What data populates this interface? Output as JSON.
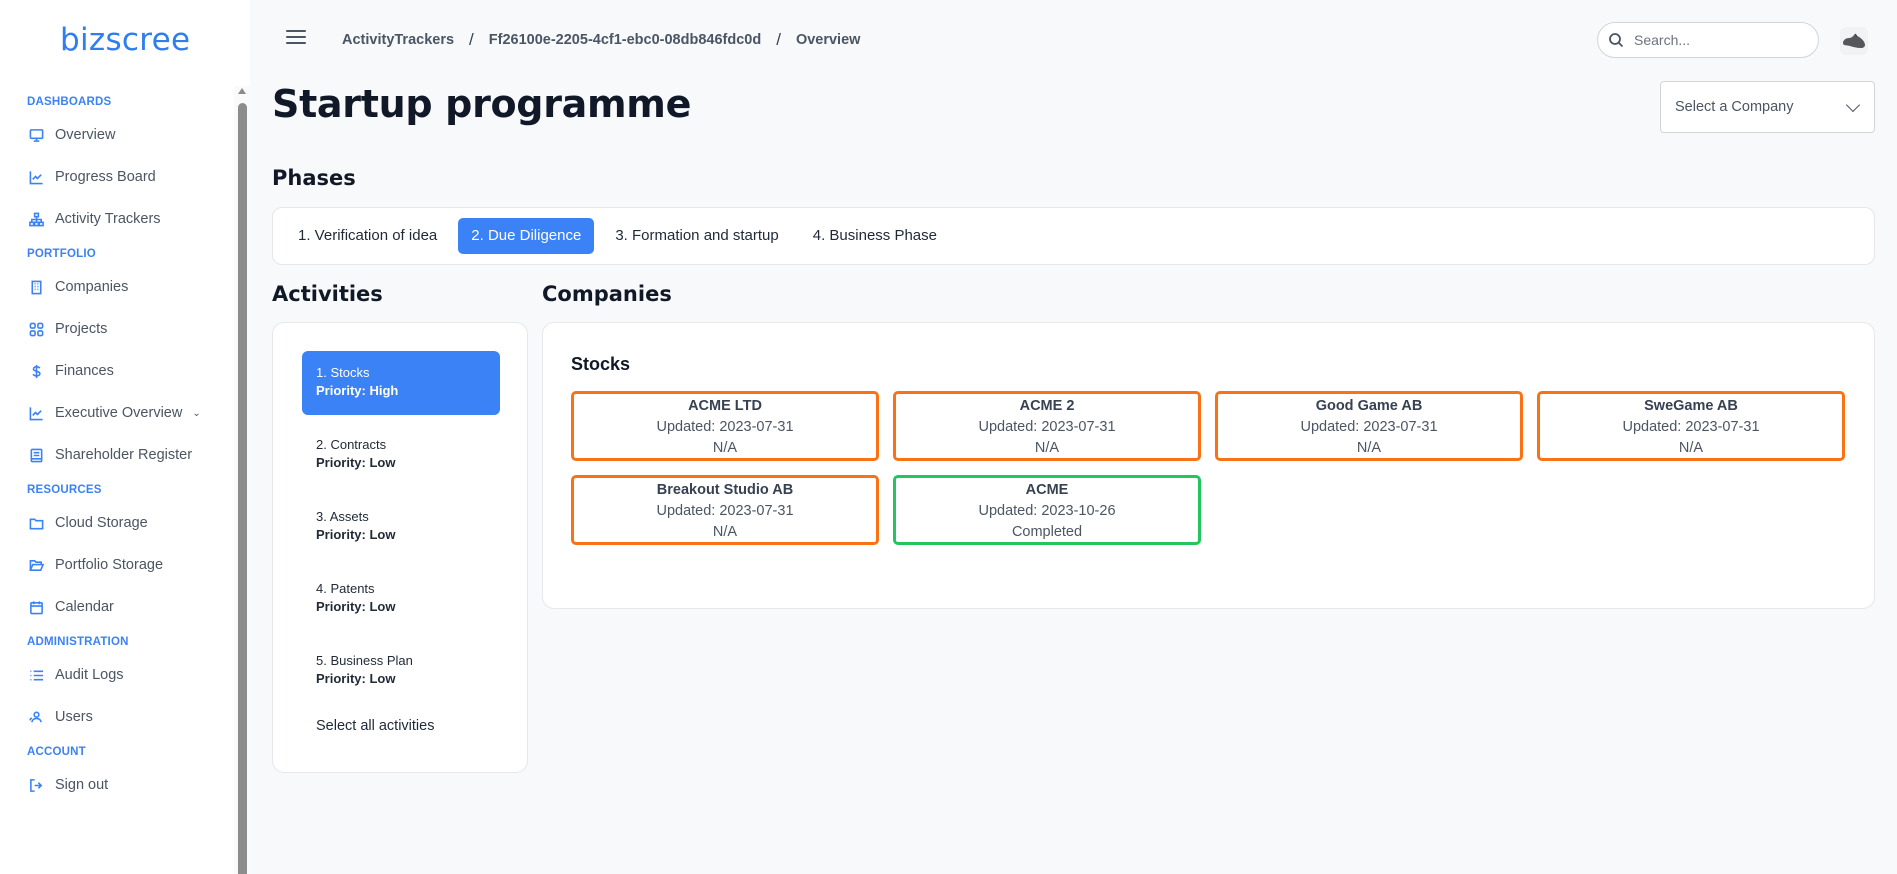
{
  "brand": {
    "logo_text": "bizscree",
    "accent": "#3b82f6"
  },
  "sidebar": {
    "sections": [
      {
        "title": "DASHBOARDS",
        "items": [
          {
            "label": "Overview",
            "icon": "monitor-icon"
          },
          {
            "label": "Progress Board",
            "icon": "chart-line-icon"
          },
          {
            "label": "Activity Trackers",
            "icon": "sitemap-icon"
          }
        ]
      },
      {
        "title": "PORTFOLIO",
        "items": [
          {
            "label": "Companies",
            "icon": "building-icon"
          },
          {
            "label": "Projects",
            "icon": "grid-icon"
          },
          {
            "label": "Finances",
            "icon": "dollar-icon"
          },
          {
            "label": "Executive Overview",
            "icon": "chart-line-icon",
            "expandable": true
          },
          {
            "label": "Shareholder Register",
            "icon": "book-icon"
          }
        ]
      },
      {
        "title": "RESOURCES",
        "items": [
          {
            "label": "Cloud Storage",
            "icon": "folder-icon"
          },
          {
            "label": "Portfolio Storage",
            "icon": "folder-open-icon"
          },
          {
            "label": "Calendar",
            "icon": "calendar-icon"
          }
        ]
      },
      {
        "title": "ADMINISTRATION",
        "items": [
          {
            "label": "Audit Logs",
            "icon": "list-icon"
          },
          {
            "label": "Users",
            "icon": "users-icon"
          }
        ]
      },
      {
        "title": "ACCOUNT",
        "items": [
          {
            "label": "Sign out",
            "icon": "sign-out-icon"
          }
        ]
      }
    ]
  },
  "header": {
    "breadcrumb": [
      "ActivityTrackers",
      "Ff26100e-2205-4cf1-ebc0-08db846fdc0d",
      "Overview"
    ],
    "search_placeholder": "Search..."
  },
  "page": {
    "title": "Startup programme",
    "company_select": "Select a Company",
    "phases_heading": "Phases",
    "phases": [
      {
        "label": "1. Verification of idea",
        "active": false
      },
      {
        "label": "2. Due Diligence",
        "active": true
      },
      {
        "label": "3. Formation and startup",
        "active": false
      },
      {
        "label": "4. Business Phase",
        "active": false
      }
    ],
    "activities_heading": "Activities",
    "activities": [
      {
        "name": "1. Stocks",
        "priority": "Priority: High",
        "active": true
      },
      {
        "name": "2. Contracts",
        "priority": "Priority: Low",
        "active": false
      },
      {
        "name": "3. Assets",
        "priority": "Priority: Low",
        "active": false
      },
      {
        "name": "4. Patents",
        "priority": "Priority: Low",
        "active": false
      },
      {
        "name": "5. Business Plan",
        "priority": "Priority: Low",
        "active": false
      }
    ],
    "select_all": "Select all activities",
    "companies_heading": "Companies",
    "activity_title": "Stocks",
    "companies": [
      {
        "name": "ACME LTD",
        "updated": "Updated: 2023-07-31",
        "status": "N/A",
        "state": "pending"
      },
      {
        "name": "ACME 2",
        "updated": "Updated: 2023-07-31",
        "status": "N/A",
        "state": "pending"
      },
      {
        "name": "Good Game AB",
        "updated": "Updated: 2023-07-31",
        "status": "N/A",
        "state": "pending"
      },
      {
        "name": "SweGame AB",
        "updated": "Updated: 2023-07-31",
        "status": "N/A",
        "state": "pending"
      },
      {
        "name": "Breakout Studio AB",
        "updated": "Updated: 2023-07-31",
        "status": "N/A",
        "state": "pending"
      },
      {
        "name": "ACME",
        "updated": "Updated: 2023-10-26",
        "status": "Completed",
        "state": "completed"
      }
    ],
    "status_colors": {
      "pending": "#f97316",
      "completed": "#22c55e"
    }
  }
}
